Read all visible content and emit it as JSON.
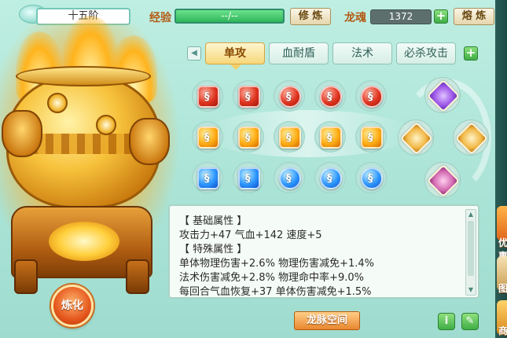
{
  "header": {
    "rank": "十五阶",
    "exp_label": "经验",
    "exp_value": "--/--",
    "cultivate_button": "修 炼",
    "soul_label": "龙魂",
    "soul_value": "1372",
    "smelt_button": "熔 炼"
  },
  "tabs": [
    {
      "label": "单攻",
      "active": true
    },
    {
      "label": "血耐盾",
      "active": false
    },
    {
      "label": "法术",
      "active": false
    },
    {
      "label": "必杀攻击",
      "active": false
    }
  ],
  "gems": {
    "rows": [
      [
        "red",
        "red",
        "red",
        "red",
        "red"
      ],
      [
        "orange",
        "orange",
        "orange",
        "orange",
        "orange"
      ],
      [
        "blue",
        "blue",
        "blue",
        "blue",
        "blue"
      ]
    ],
    "star_gems": [
      "purple",
      "gold",
      "gold",
      "violet"
    ]
  },
  "attributes": {
    "lines": [
      "【 基础属性 】",
      "攻击力+47  气血+142  速度+5",
      "【 特殊属性 】",
      "单体物理伤害+2.6%  物理伤害减免+1.4%",
      "法术伤害减免+2.8%  物理命中率+9.0%",
      "每回合气血恢复+37  单体伤害减免+1.5%"
    ]
  },
  "refine_button": "炼化",
  "vein_button": "龙脉空间",
  "side_strip": {
    "items": [
      "优惠",
      "图",
      "商"
    ]
  },
  "colors": {
    "panel_bg": "#a9e3d6",
    "active_tab": "#f6d77a",
    "accent_orange": "#e9872f"
  }
}
